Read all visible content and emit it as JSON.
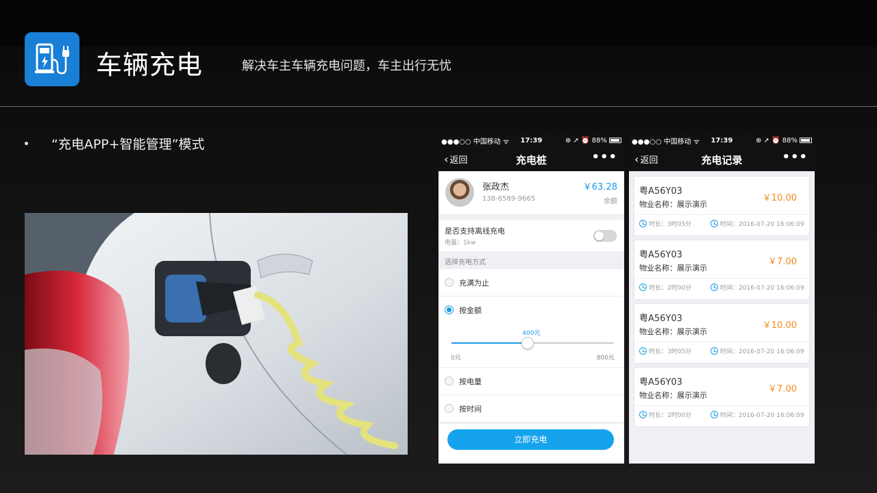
{
  "slide": {
    "title": "车辆充电",
    "subtitle": "解决车主车辆充电问题，车主出行无忧",
    "bullet": "“充电APP+智能管理”模式",
    "logo_icon": "ev-charger-icon",
    "logo_color": "#1a7fd6"
  },
  "status_bar": {
    "carrier": "●●●○○ 中国移动 ᯤ",
    "time": "17:39",
    "indicators": "⊕ ➚ ⏰ 88%"
  },
  "phone1": {
    "back_label": "返回",
    "title": "充电桩",
    "more": "•••",
    "user": {
      "name": "张政杰",
      "phone": "138-6589-9665",
      "balance": "￥63.28",
      "balance_label": "余额"
    },
    "offline": {
      "title": "是否支持离线充电",
      "sub": "电量：1kw",
      "enabled": false
    },
    "section_label": "选择充电方式",
    "options": [
      {
        "label": "充满为止",
        "selected": false
      },
      {
        "label": "按金额",
        "selected": true
      },
      {
        "label": "按电量",
        "selected": false
      },
      {
        "label": "按时间",
        "selected": false
      }
    ],
    "slider": {
      "value_label": "400元",
      "min_label": "0元",
      "max_label": "800元",
      "fraction": 0.47
    },
    "charge_button": "立即充电",
    "accent": "#1a9be6"
  },
  "phone2": {
    "back_label": "返回",
    "title": "充电记录",
    "more": "•••",
    "records": [
      {
        "plate": "粤A56Y03",
        "property": "物业名称：展示演示",
        "price": "￥10.00",
        "duration": "时长：3时05分",
        "time": "时间：2016-07-20  16:06:09"
      },
      {
        "plate": "粤A56Y03",
        "property": "物业名称：展示演示",
        "price": "￥7.00",
        "duration": "时长：2时00分",
        "time": "时间：2016-07-20  16:06:09"
      },
      {
        "plate": "粤A56Y03",
        "property": "物业名称：展示演示",
        "price": "￥10.00",
        "duration": "时长：3时05分",
        "time": "时间：2016-07-20  16:06:09"
      },
      {
        "plate": "粤A56Y03",
        "property": "物业名称：展示演示",
        "price": "￥7.00",
        "duration": "时长：2时00分",
        "time": "时间：2016-07-20  16:06:09"
      }
    ],
    "price_color": "#f08a1c"
  }
}
